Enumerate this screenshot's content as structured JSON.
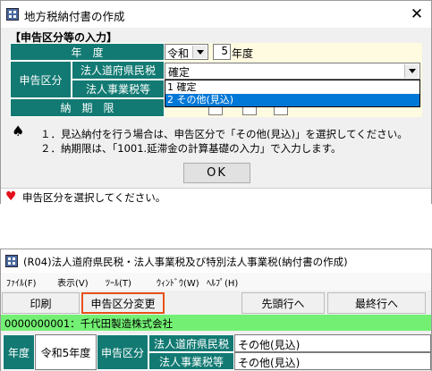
{
  "dialog": {
    "title": "地方税納付書の作成",
    "close_glyph": "✕",
    "section_label": "【申告区分等の入力】",
    "nendo_label": "年　度",
    "era_value": "令和",
    "year_value": "5",
    "year_suffix": "年度",
    "shinkoku_label": "申告区分",
    "row1_label": "法人道府県民税",
    "row1_value": "確定",
    "row2_label": "法人事業税等",
    "nouki_label": "納　期　限",
    "dropdown_options": [
      "1  確定",
      "2  その他(見込)"
    ],
    "notes": [
      "１．見込納付を行う場合は、申告区分で「その他(見込)」を選択してください。",
      "２．納期限は、「1001.延滞金の計算基礎の入力」で入力します。"
    ],
    "ok_label": "OK",
    "status_text": "申告区分を選択してください。"
  },
  "window": {
    "title": "(R04)法人道府県民税・法人事業税及び特別法人事業税(納付書の作成)",
    "menu": [
      "ﾌｧｲﾙ(F)",
      "表示(V)",
      "ﾂｰﾙ(T)",
      "ｳｨﾝﾄﾞｳ(W)",
      "ﾍﾙﾌﾟ(H)"
    ],
    "toolbar": {
      "print": "印刷",
      "change": "申告区分変更",
      "first": "先頭行へ",
      "last": "最終行へ"
    },
    "company": "0000000001：千代田製造株式会社",
    "nendo_label": "年度",
    "nendo_value": "令和5年度",
    "shinkoku_label": "申告区分",
    "row1_label": "法人道府県民税",
    "row1_value": "その他(見込)",
    "row2_label": "法人事業税等",
    "row2_value": "その他(見込)"
  },
  "colors": {
    "teal": "#127a73",
    "highlight": "#0078d7",
    "green_bar": "#73f073",
    "orange_outline": "#e8501a",
    "heart": "#e3101a"
  },
  "icons": {
    "app": "app-icon",
    "spade": "spade-icon",
    "heart": "heart-icon"
  }
}
